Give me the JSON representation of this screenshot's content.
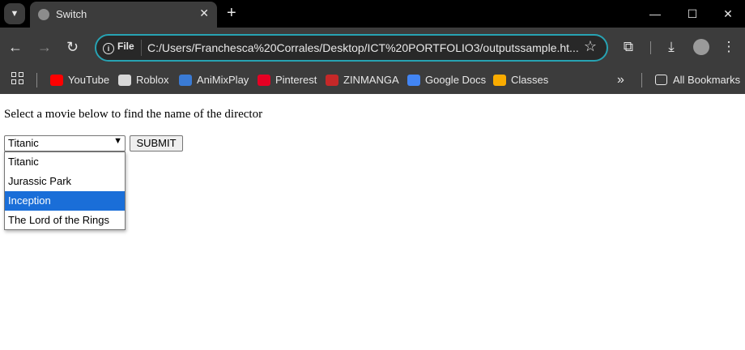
{
  "browser": {
    "tab_title": "Switch",
    "url_chip": "File",
    "url": "C:/Users/Franchesca%20Corrales/Desktop/ICT%20PORTFOLIO3/outputssample.ht...",
    "bookmarks": [
      {
        "label": "YouTube",
        "icon": "youtube-icon",
        "color": "#ff0000"
      },
      {
        "label": "Roblox",
        "icon": "roblox-icon",
        "color": "#d8d8d8"
      },
      {
        "label": "AniMixPlay",
        "icon": "animixplay-icon",
        "color": "#3a7bd5"
      },
      {
        "label": "Pinterest",
        "icon": "pinterest-icon",
        "color": "#e60023"
      },
      {
        "label": "ZINMANGA",
        "icon": "zinmanga-icon",
        "color": "#c62828"
      },
      {
        "label": "Google Docs",
        "icon": "google-docs-icon",
        "color": "#4285f4"
      },
      {
        "label": "Classes",
        "icon": "google-classroom-icon",
        "color": "#f9ab00"
      }
    ],
    "all_bookmarks": "All Bookmarks"
  },
  "page": {
    "prompt": "Select a movie below to find the name of the director",
    "select": {
      "value": "Titanic",
      "options": [
        "Titanic",
        "Jurassic Park",
        "Inception",
        "The Lord of the Rings"
      ],
      "highlighted": "Inception"
    },
    "submit_label": "SUBMIT"
  },
  "colors": {
    "highlight": "#1a6ed8",
    "omnibox_border": "#27a3b3"
  }
}
